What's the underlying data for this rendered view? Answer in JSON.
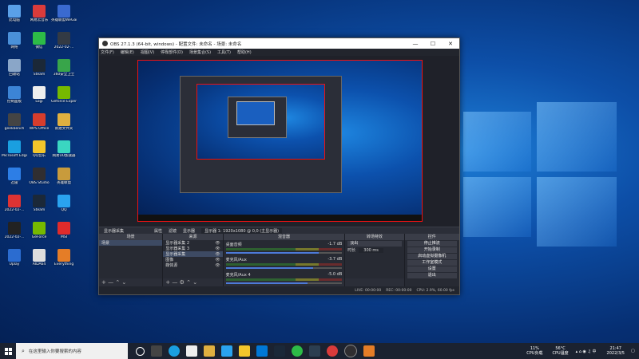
{
  "desktop_icons": [
    {
      "label": "此电脑",
      "color": "#5aa0e8"
    },
    {
      "label": "网易云音乐",
      "color": "#d93b3b"
    },
    {
      "label": "英雄联盟WeGame版",
      "color": "#3a6ad0"
    },
    {
      "label": "网络",
      "color": "#4a90d9"
    },
    {
      "label": "微信",
      "color": "#2dbb47"
    },
    {
      "label": "2022-02-...",
      "color": "#333a44"
    },
    {
      "label": "回收站",
      "color": "#8aa6c8"
    },
    {
      "label": "Steam",
      "color": "#1b2838"
    },
    {
      "label": "360安全卫士",
      "color": "#38a54a"
    },
    {
      "label": "控制面板",
      "color": "#3c84d6"
    },
    {
      "label": "Logi",
      "color": "#eeeeee"
    },
    {
      "label": "Geforce Experience",
      "color": "#76b900"
    },
    {
      "label": "geekbench",
      "color": "#444"
    },
    {
      "label": "WPS Office",
      "color": "#d63d2d"
    },
    {
      "label": "新建文件夹",
      "color": "#e0b040"
    },
    {
      "label": "Microsoft Edge",
      "color": "#1a9fe0"
    },
    {
      "label": "QQ音乐",
      "color": "#f3c62b"
    },
    {
      "label": "网易UU加速器",
      "color": "#3ad6c1"
    },
    {
      "label": "迅雷",
      "color": "#2d7ee6"
    },
    {
      "label": "OBS Studio",
      "color": "#302e31"
    },
    {
      "label": "英雄联盟",
      "color": "#c89b3c"
    },
    {
      "label": "2022-02-...",
      "color": "#d33"
    },
    {
      "label": "Steam",
      "color": "#1b2838"
    },
    {
      "label": "QQ",
      "color": "#2aa3ef"
    },
    {
      "label": "2022-02-...",
      "color": "#222"
    },
    {
      "label": "GeForce",
      "color": "#76b900"
    },
    {
      "label": "MSI",
      "color": "#e02b2b"
    },
    {
      "label": "Uplay",
      "color": "#2b6cd0"
    },
    {
      "label": "AIDA64",
      "color": "#ddd"
    },
    {
      "label": "Everything",
      "color": "#e57d27"
    }
  ],
  "obs": {
    "title": "OBS 27.1.3 (64-bit, windows) - 配置文件: 未命名 - 场景: 未命名",
    "menu": [
      "文件(F)",
      "编辑(E)",
      "视图(V)",
      "停靠部件(D)",
      "场景集合(S)",
      "工具(T)",
      "帮助(H)"
    ],
    "window_buttons": [
      "—",
      "☐",
      "✕"
    ],
    "source_bar": {
      "scene": "显示器采集",
      "props": "属性",
      "filter": "滤镜",
      "display": "显示器",
      "display_value": "显示器 1: 1920x1080 @ 0,0 (主显示器)"
    },
    "docks": {
      "scenes": {
        "title": "场景",
        "items": [
          "场景"
        ]
      },
      "sources": {
        "title": "来源",
        "items": [
          "显示器采集 2",
          "显示器采集 3",
          "显示器采集",
          "图像",
          "媒体源"
        ]
      },
      "mixer": {
        "title": "混音器",
        "channels": [
          {
            "name": "桌面音频",
            "db": "-1.7 dB"
          },
          {
            "name": "麦克风/Aux",
            "db": "-3.7 dB"
          },
          {
            "name": "麦克风/Aux 4",
            "db": "-5.0 dB"
          }
        ]
      },
      "transitions": {
        "title": "转场特效",
        "type": "淡出",
        "duration_label": "时长",
        "duration": "300 ms"
      },
      "controls": {
        "title": "控件",
        "buttons": [
          "停止推流",
          "开始录制",
          "启动虚拟摄像机",
          "工作室模式",
          "设置",
          "退出"
        ]
      }
    },
    "status": {
      "live": "LIVE: 00:00:00",
      "rec": "REC: 00:00:00",
      "cpu": "CPU: 2.9%, 60.00 fps"
    }
  },
  "taskbar": {
    "search_placeholder": "在这里输入你要搜索的内容",
    "cpu_temp": "11%",
    "cpu_label": "CPU负载",
    "gpu_temp": "56°C",
    "gpu_label": "CPU温度",
    "time": "21:47",
    "date": "2022/3/5"
  }
}
